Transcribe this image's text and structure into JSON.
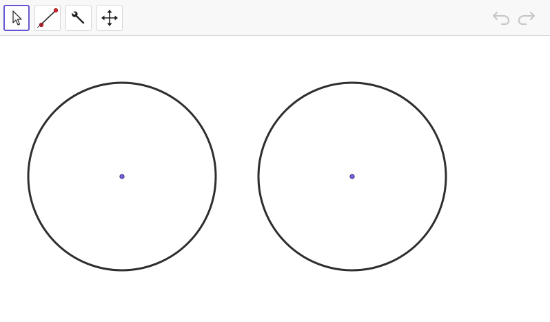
{
  "toolbar": {
    "tools": [
      {
        "name": "move-tool",
        "icon": "arrow-cursor-icon",
        "selected": true
      },
      {
        "name": "segment-tool",
        "icon": "segment-icon",
        "selected": false
      },
      {
        "name": "tools-menu",
        "icon": "wrench-icon",
        "selected": false
      },
      {
        "name": "move-graphics-view",
        "icon": "move-arrows-icon",
        "selected": false
      }
    ],
    "undo": {
      "icon": "undo-icon",
      "enabled": false
    },
    "redo": {
      "icon": "redo-icon",
      "enabled": false
    }
  },
  "colors": {
    "accent": "#6557d2",
    "circle_stroke": "#2e2e2e",
    "point_fill": "#7562d9",
    "disabled_icon": "#c8c8c8",
    "toolbar_bg": "#f8f8f8"
  },
  "graphics": {
    "circles": [
      {
        "name": "circle-c"
      },
      {
        "name": "circle-d"
      }
    ],
    "points": [
      {
        "name": "center-a"
      },
      {
        "name": "center-b"
      }
    ]
  }
}
